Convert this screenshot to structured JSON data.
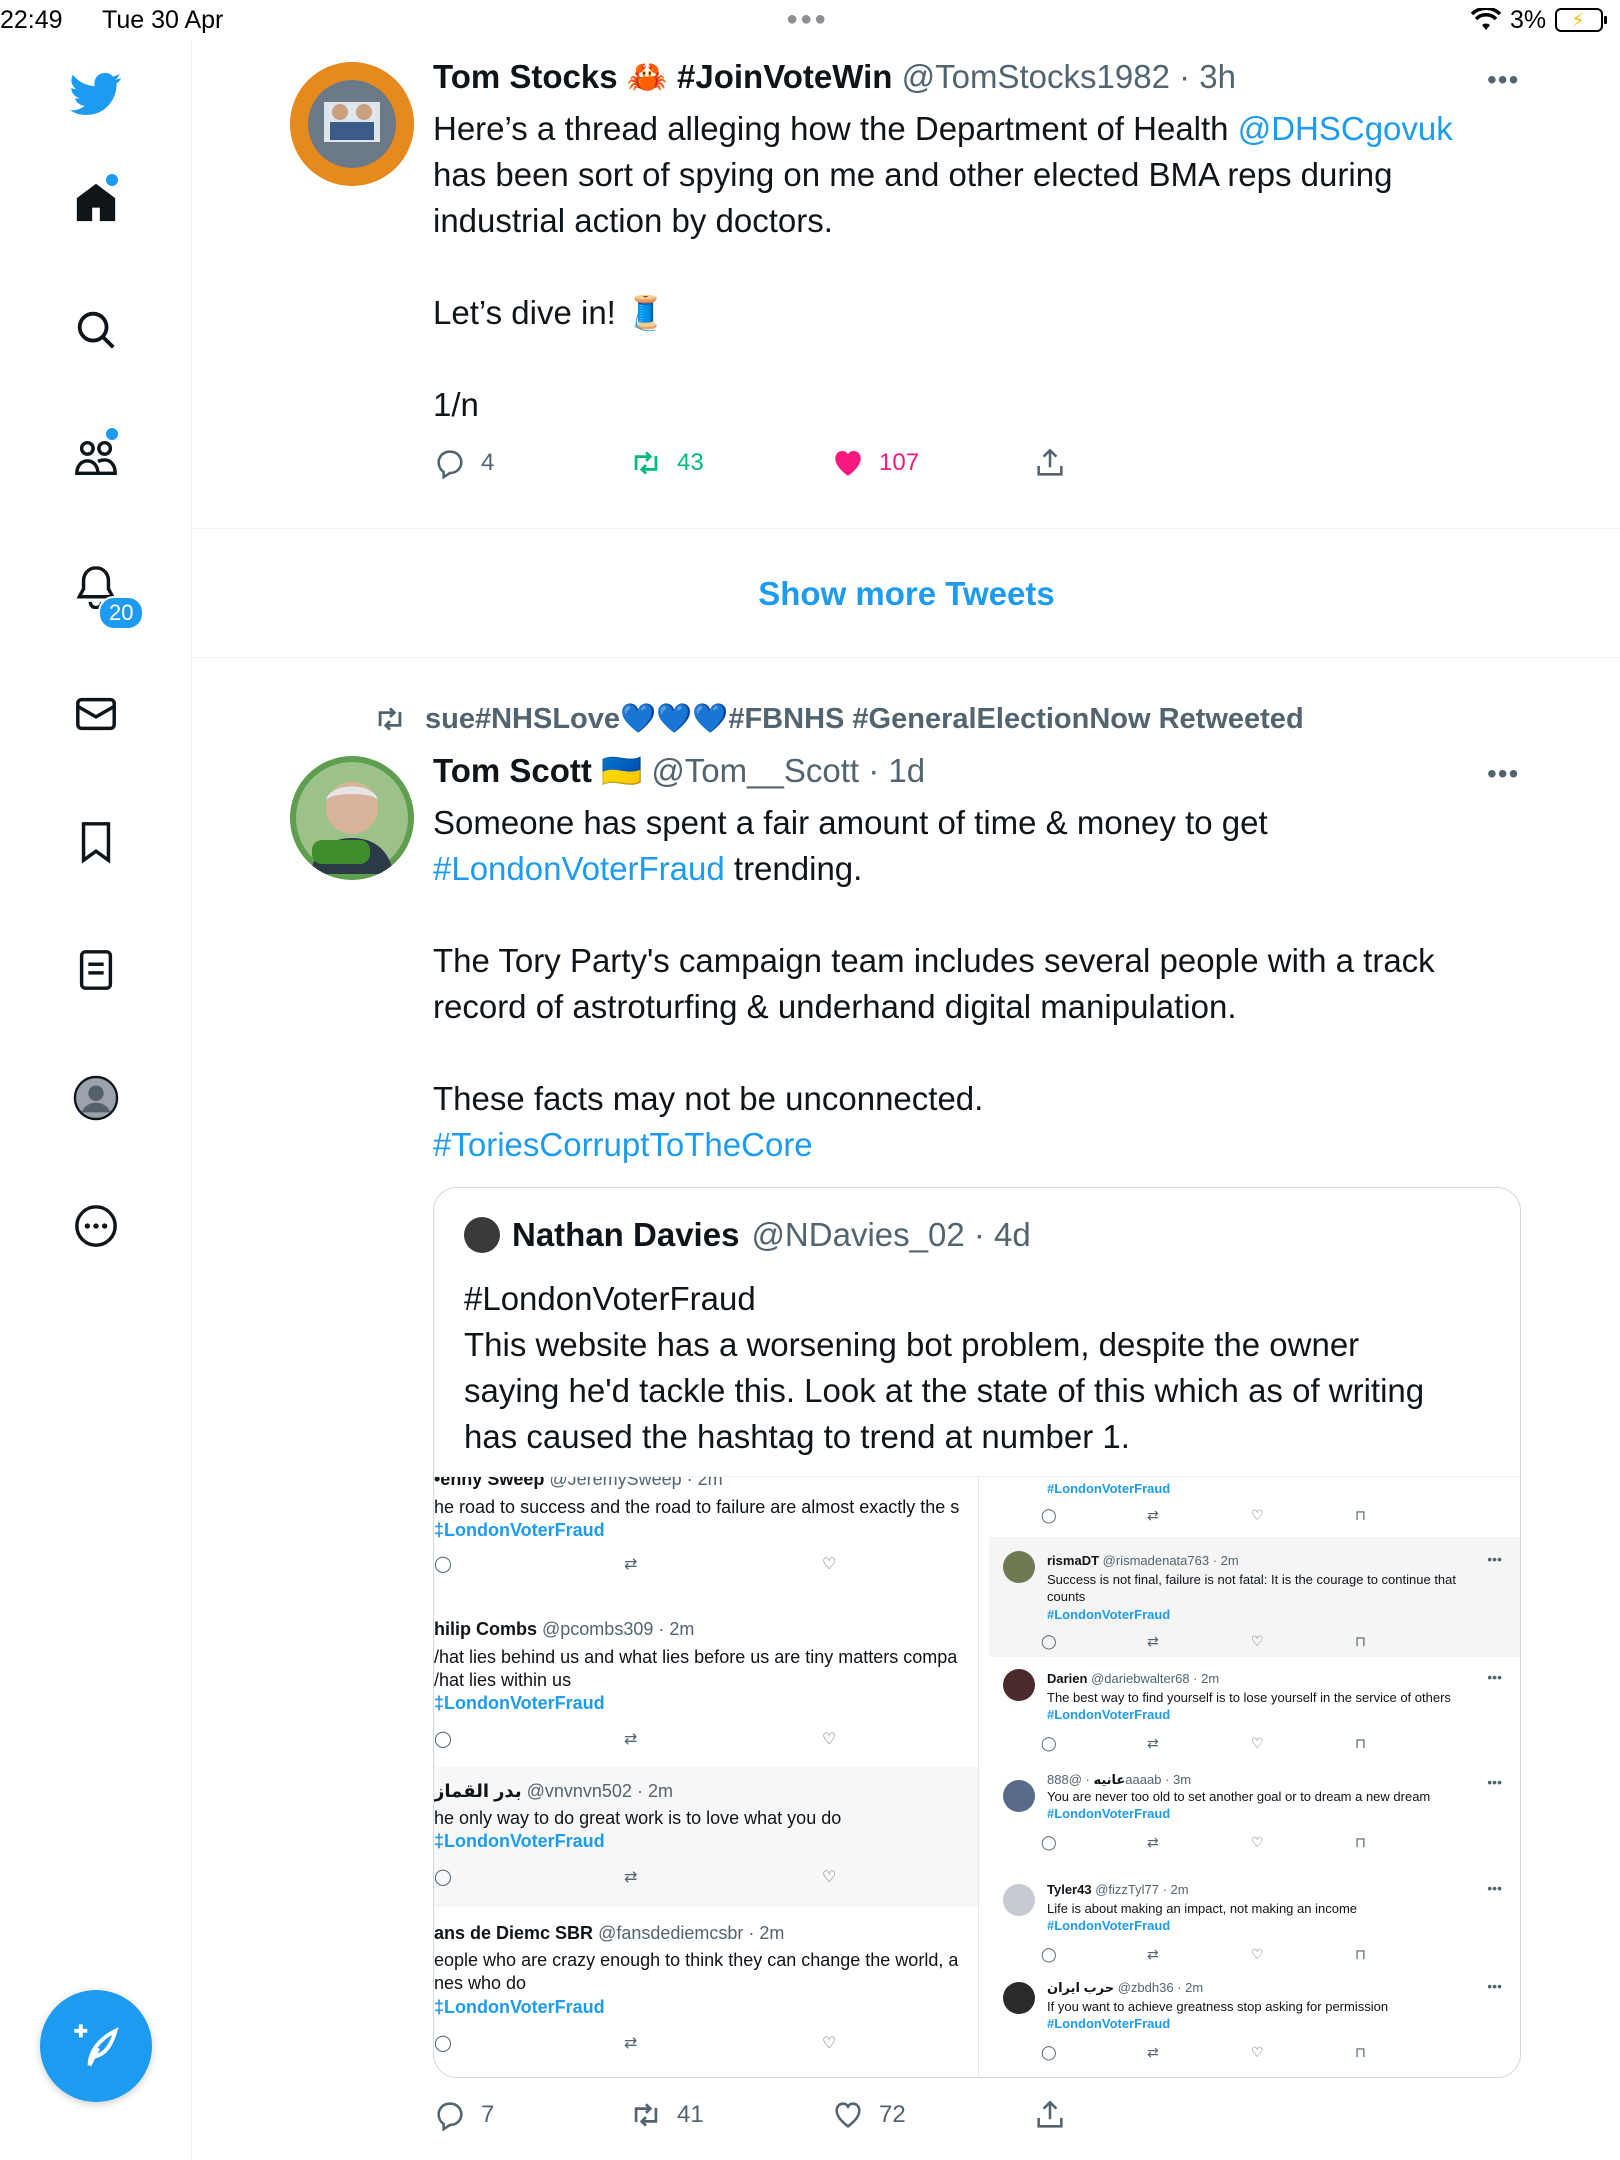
{
  "status_bar": {
    "time": "22:49",
    "date": "Tue 30 Apr",
    "battery": "3%"
  },
  "sidebar": {
    "notification_count": "20"
  },
  "tweet1": {
    "name": "Tom Stocks 🦀 #JoinVoteWin",
    "handle": "@TomStocks1982 · 3h",
    "text_before_link": "Here’s a thread alleging how the Department of Health ",
    "mention": "@DHSCgovuk",
    "text_after_link": "\nhas been sort of spying on me and other elected BMA reps during\nindustrial action by doctors.\n\nLet’s dive in! 🧵\n\n1/n",
    "replies": "4",
    "retweets": "43",
    "likes": "107"
  },
  "show_more": "Show more Tweets",
  "tweet2": {
    "retweeted_by": "sue#NHSLove💙💙💙#FBNHS #GeneralElectionNow Retweeted",
    "name": "Tom Scott 🇺🇦",
    "handle": "@Tom__Scott · 1d",
    "text_line1": "Someone has spent a fair amount of time & money to get",
    "hashtag1": "#LondonVoterFraud",
    "text_line2": " trending.",
    "text_para2": "The Tory Party's campaign team includes several people with a track\nrecord of astroturfing & underhand digital manipulation.",
    "text_para3": "These facts may not be unconnected.",
    "hashtag2": "#ToriesCorruptToTheCore",
    "replies": "7",
    "retweets": "41",
    "likes": "72",
    "quote": {
      "name": "Nathan Davies",
      "handle": "@NDavies_02 · 4d",
      "text": "#LondonVoterFraud\nThis website has a worsening bot problem, despite the owner\nsaying he'd tackle this. Look at the state of this which as of writing\nhas caused the hashtag to trend at number 1.",
      "image": {
        "left_posts": [
          {
            "head_name": "",
            "head_handle": "",
            "text": "he road to success and the road to failure are almost exactly the s",
            "tag": "‡LondonVoterFraud"
          },
          {
            "head_name": "hilip Combs",
            "head_handle": "@pcombs309 · 2m",
            "text": "/hat lies behind us and what lies before us are tiny matters compa\n/hat lies within us",
            "tag": "‡LondonVoterFraud"
          },
          {
            "head_name": "بدر القماز",
            "head_handle": "@vnvnvn502 · 2m",
            "text": "he only way to do great work is to love what you do",
            "tag": "‡LondonVoterFraud"
          },
          {
            "head_name": "ans de Diemc SBR",
            "head_handle": "@fansdediemcsbr · 2m",
            "text": "eople who are crazy enough to think they can change the world, a\nnes who do",
            "tag": "‡LondonVoterFraud"
          }
        ],
        "right_posts": [
          {
            "name": "",
            "handle": "",
            "text": "",
            "tag": "#LondonVoterFraud"
          },
          {
            "name": "rismaDT",
            "handle": "@rismadenata763 · 2m",
            "text": "Success is not final, failure is not fatal: It is the courage to continue that\ncounts",
            "tag": "#LondonVoterFraud"
          },
          {
            "name": "Darien",
            "handle": "@dariebwalter68 · 2m",
            "text": "The best way to find yourself is to lose yourself in the service of others",
            "tag": "#LondonVoterFraud"
          },
          {
            "name": "",
            "handle": "",
            "text": "You are never too old to set another goal or to dream a new dream",
            "tag": "#LondonVoterFraud"
          },
          {
            "name": "Tyler43",
            "handle": "@fizzTyl77 · 2m",
            "text": "Life is about making an impact, not making an income",
            "tag": "#LondonVoterFraud"
          },
          {
            "name": "حرب ایران",
            "handle": "@zbdh36 · 2m",
            "text": "If you want to achieve greatness stop asking for permission",
            "tag": "#LondonVoterFraud"
          }
        ]
      }
    }
  },
  "colors": {
    "accent": "#1d9bf0",
    "retweet_green": "#00ba7c",
    "like_pink": "#f91880",
    "secondary_text": "#536471"
  },
  "icons": [
    "twitter-logo-icon",
    "home-icon",
    "search-icon",
    "communities-icon",
    "bell-icon",
    "mail-icon",
    "bookmark-icon",
    "lists-icon",
    "profile-icon",
    "more-icon",
    "compose-icon",
    "reply-icon",
    "retweet-icon",
    "heart-icon",
    "share-icon"
  ]
}
